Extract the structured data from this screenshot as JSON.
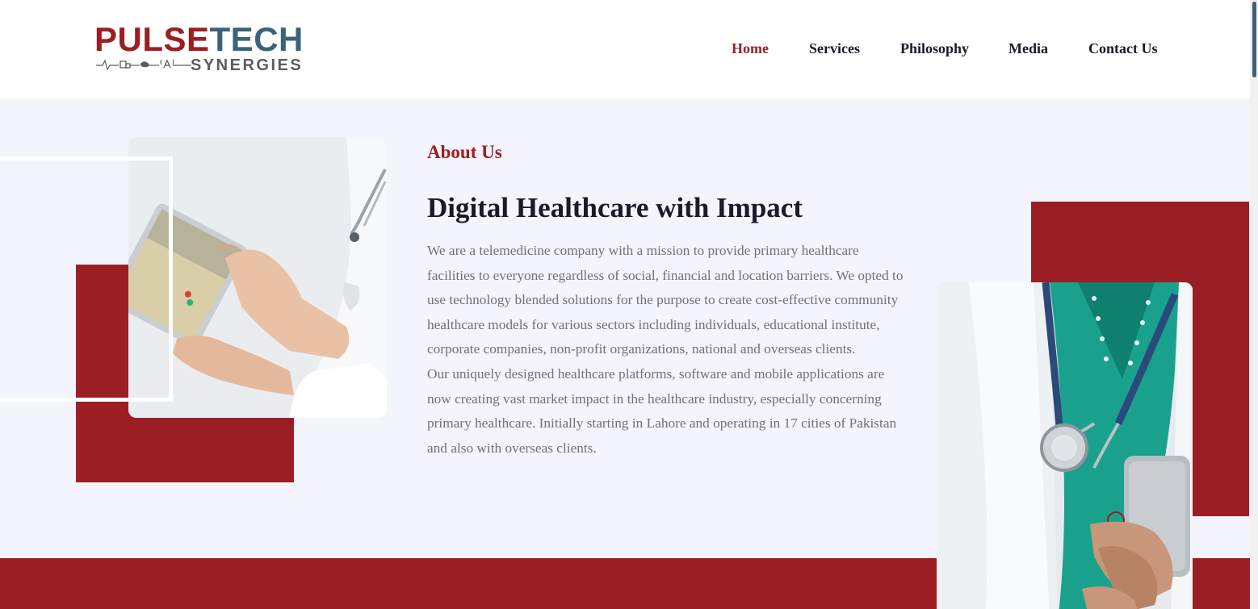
{
  "brand": {
    "name_part1": "PULSE",
    "name_part2": "TECH",
    "tagline": "SYNERGIES",
    "colors": {
      "primary_red": "#9b1e24",
      "secondary_teal": "#3c6278"
    }
  },
  "nav": {
    "items": [
      {
        "label": "Home",
        "active": true
      },
      {
        "label": "Services",
        "active": false
      },
      {
        "label": "Philosophy",
        "active": false
      },
      {
        "label": "Media",
        "active": false
      },
      {
        "label": "Contact Us",
        "active": false
      }
    ]
  },
  "about": {
    "label": "About Us",
    "title": "Digital Healthcare with Impact",
    "paragraph1": "We are a telemedicine company with a mission to provide primary healthcare facilities to everyone regardless of social, financial and location barriers. We opted to use technology blended solutions for the purpose to create cost-effective community healthcare models for various sectors including individuals, educational institute, corporate companies, non-profit organizations, national and overseas clients.",
    "paragraph2": "Our uniquely designed healthcare platforms, software and mobile applications are now creating vast market impact in the healthcare industry, especially concerning primary healthcare. Initially starting in Lahore and operating in 17 cities of Pakistan and also with overseas clients."
  },
  "images": {
    "left": "doctor-tablet-image",
    "right": "doctor-stethoscope-image"
  }
}
